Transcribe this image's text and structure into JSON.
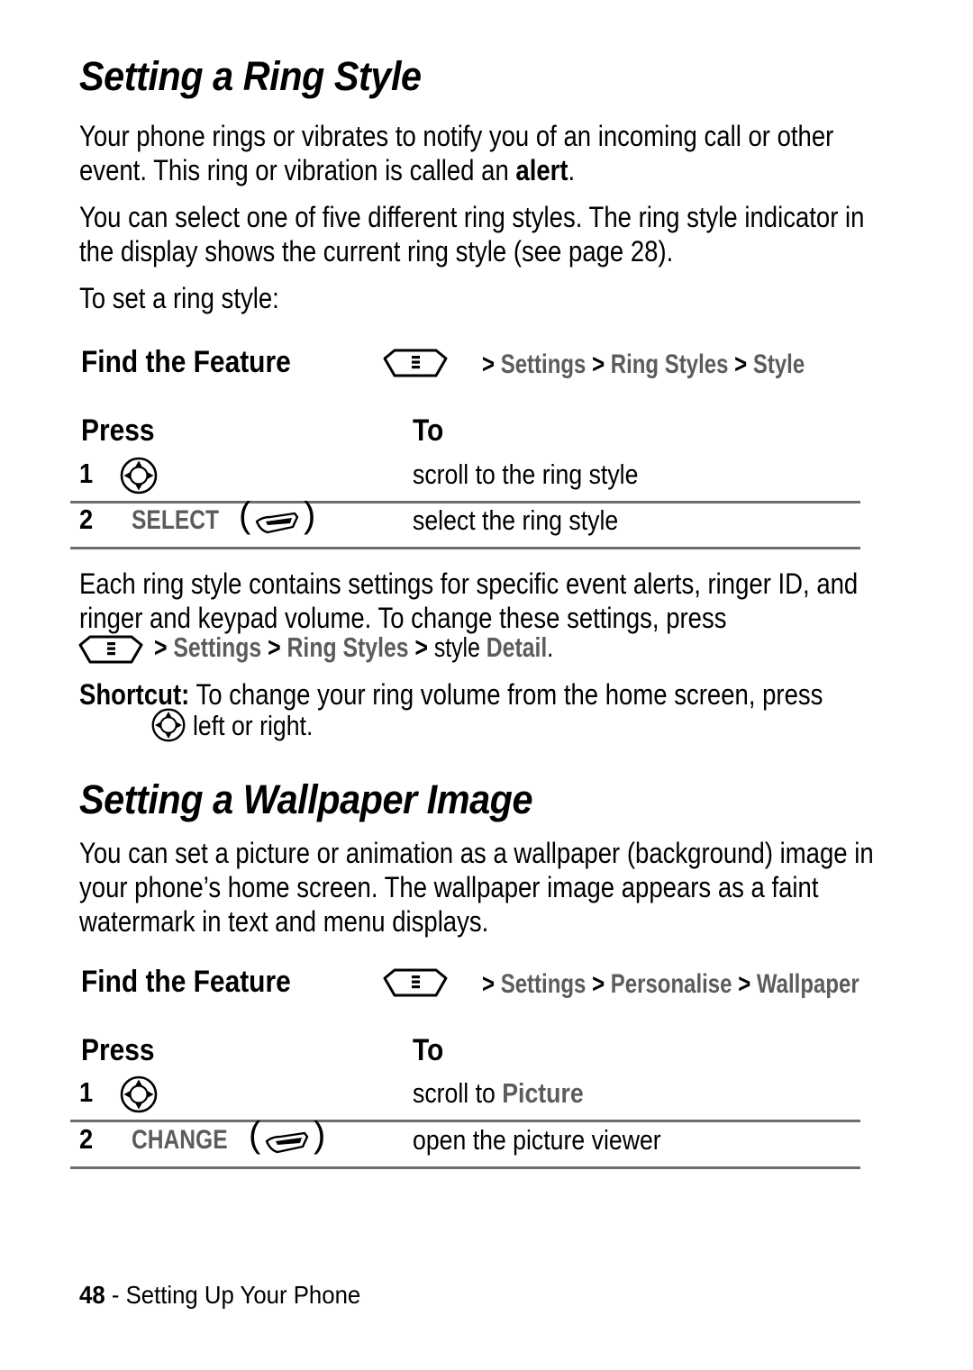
{
  "document": {
    "page_number": "48",
    "footer_separator": "-",
    "footer_section": "Setting Up Your Phone"
  },
  "sections": [
    {
      "heading": "Setting a Ring Style",
      "paragraphs": [
        {
          "runs": [
            {
              "text": "Your phone rings or vibrates to notify you of an incoming call or other event. This ring or vibration is called an ",
              "style": "normal"
            },
            {
              "text": "alert",
              "style": "bold"
            },
            {
              "text": ".",
              "style": "normal"
            }
          ]
        },
        {
          "runs": [
            {
              "text": "You can select one of five different ring styles. The ring style indicator in the display shows the current ring style (see page 28).",
              "style": "normal"
            }
          ]
        },
        {
          "runs": [
            {
              "text": "To set a ring style:",
              "style": "normal"
            }
          ]
        }
      ],
      "find_the_feature": {
        "label": "Find the Feature",
        "key_icon": "menu-key-icon",
        "path_prefix": ">",
        "path_items": [
          "Settings",
          "Ring Styles",
          "Style"
        ],
        "path_separator": ">"
      },
      "table": {
        "col_press": "Press",
        "col_to": "To",
        "rows": [
          {
            "number": "1",
            "key_label": "",
            "key_icon": "navigation-key-icon",
            "action_prefix": "scroll to the ring style",
            "action_highlight": ""
          },
          {
            "number": "2",
            "key_label": "SELECT",
            "key_icon": "soft-key-icon",
            "action_prefix": "select the ring style",
            "action_highlight": ""
          }
        ]
      }
    },
    {
      "heading": "Setting a Wallpaper Image",
      "paragraphs": [
        {
          "runs": [
            {
              "text": "You can set a picture or animation as a wallpaper (background) image in your phone’s home screen. The wallpaper image appears as a faint watermark in text and menu displays.",
              "style": "normal"
            }
          ]
        }
      ],
      "find_the_feature": {
        "label": "Find the Feature",
        "key_icon": "menu-key-icon",
        "path_prefix": ">",
        "path_items": [
          "Settings",
          "Personalise",
          "Wallpaper"
        ],
        "path_separator": ">"
      },
      "table": {
        "col_press": "Press",
        "col_to": "To",
        "rows": [
          {
            "number": "1",
            "key_label": "",
            "key_icon": "navigation-key-icon",
            "action_prefix": "scroll to ",
            "action_highlight": "Picture"
          },
          {
            "number": "2",
            "key_label": "CHANGE",
            "key_icon": "soft-key-icon",
            "action_prefix": "open the picture viewer",
            "action_highlight": ""
          }
        ]
      }
    }
  ],
  "middle_note": {
    "lead_text": "Each ring style contains settings for specific event alerts, ringer ID, and ringer and keypad volume. To change these settings, press",
    "key_icon": "menu-key-icon",
    "path_prefix": ">",
    "path_settings": "Settings",
    "path_ringstyles": "Ring Styles",
    "path_style_word": "style",
    "path_detail": "Detail",
    "path_separator": ">",
    "path_end": "."
  },
  "shortcut": {
    "label": "Shortcut:",
    "text_before": " To change your ring volume from the home screen, press",
    "key_icon": "navigation-key-icon",
    "text_after": "left or right."
  },
  "colors": {
    "text": "#000000",
    "menu_path_gray": "#5c5c5c",
    "rule_gray": "#6e6e6e",
    "background": "#ffffff"
  }
}
